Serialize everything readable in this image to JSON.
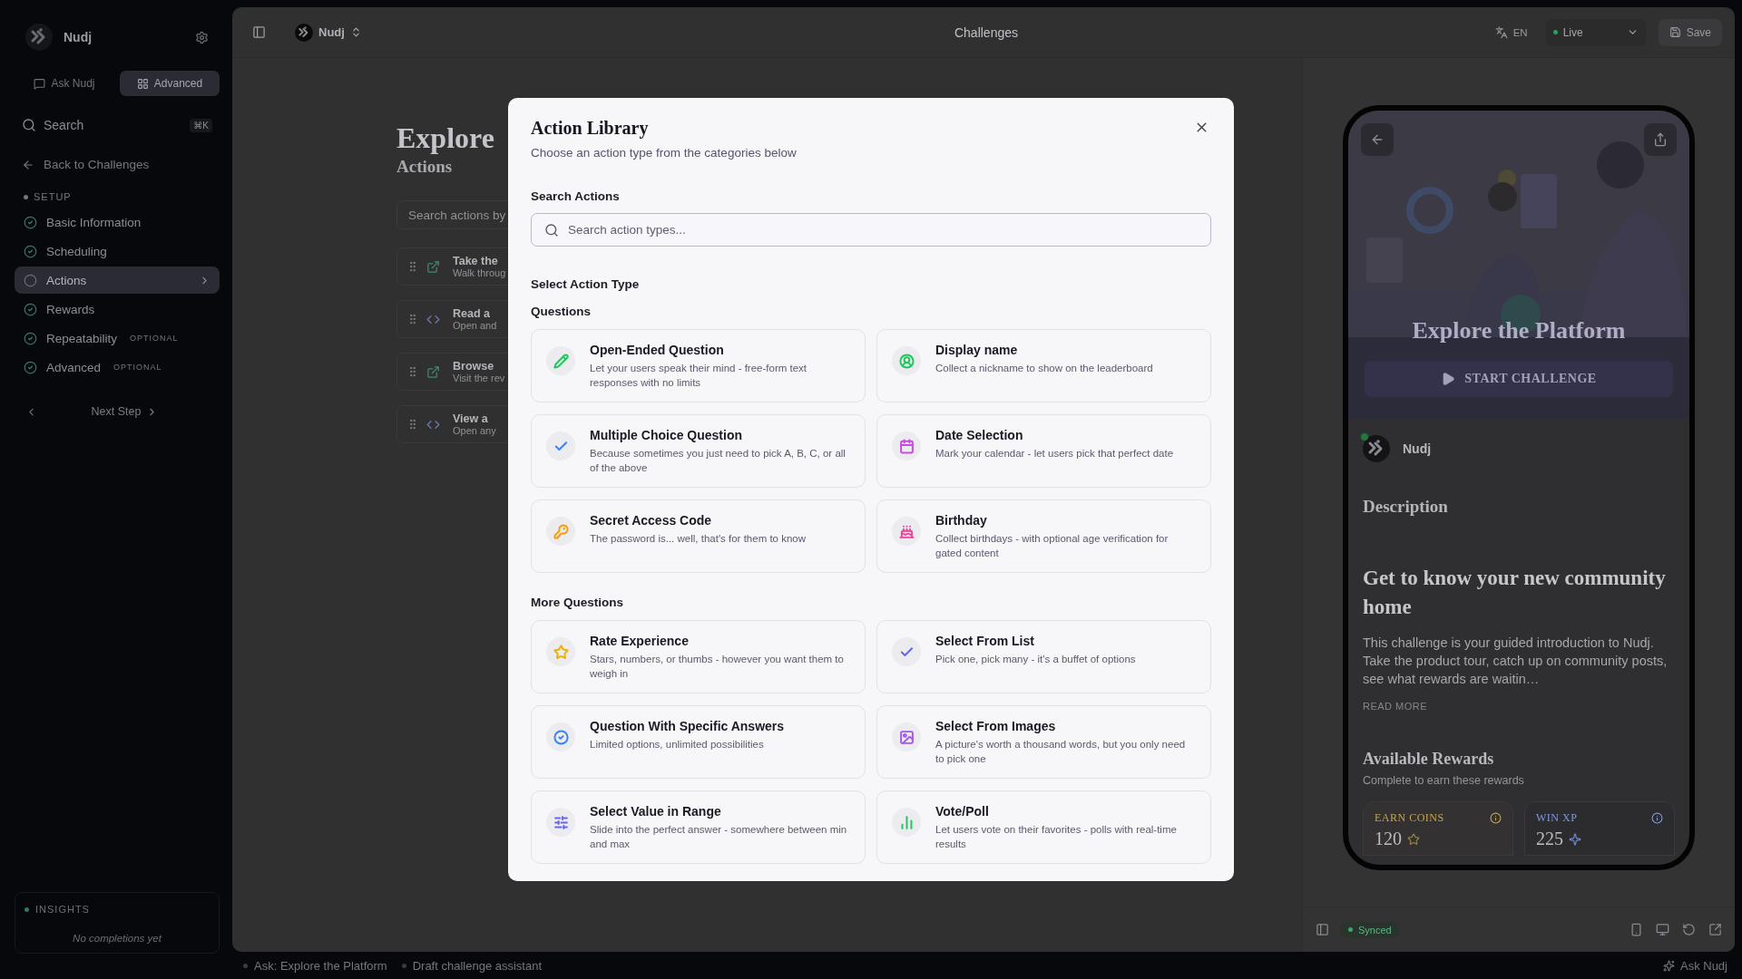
{
  "sidebar": {
    "brand": "Nudj",
    "modes": [
      {
        "label": "Ask Nudj",
        "selected": false
      },
      {
        "label": "Advanced",
        "selected": true
      }
    ],
    "search": {
      "placeholder": "Search",
      "shortcut": "⌘K"
    },
    "back_link": "Back to Challenges",
    "section": "SETUP",
    "steps": [
      {
        "label": "Basic Information",
        "done": true,
        "selected": false
      },
      {
        "label": "Scheduling",
        "done": true,
        "selected": false
      },
      {
        "label": "Actions",
        "done": false,
        "selected": true
      },
      {
        "label": "Rewards",
        "done": true,
        "selected": false
      },
      {
        "label": "Repeatability",
        "badge": "OPTIONAL",
        "done": true,
        "selected": false
      },
      {
        "label": "Advanced",
        "badge": "OPTIONAL",
        "done": true,
        "selected": false
      }
    ],
    "next_step": "Next Step",
    "insights": {
      "title": "INSIGHTS",
      "empty": "No completions yet"
    }
  },
  "topbar": {
    "workspace": "Nudj",
    "title": "Challenges",
    "language": "EN",
    "status": "Live",
    "save": "Save"
  },
  "editor": {
    "title": "Explore",
    "subtitle": "Actions",
    "search_placeholder": "Search actions by",
    "actions": [
      {
        "kind": "link",
        "title": "Take the",
        "description": "Walk throug"
      },
      {
        "kind": "code",
        "title": "Read a",
        "description": "Open and"
      },
      {
        "kind": "link",
        "title": "Browse",
        "description": "Visit the rev"
      },
      {
        "kind": "code",
        "title": "View a",
        "description": "Open any"
      }
    ]
  },
  "preview": {
    "title": "Explore the Platform",
    "start": "START CHALLENGE",
    "brand": "Nudj",
    "description_heading": "Description",
    "headline": "Get to know your new community home",
    "body": "This challenge is your guided introduction to Nudj. Take the product tour, catch up on community posts, see what rewards are waitin…",
    "read_more": "READ MORE",
    "rewards_title": "Available Rewards",
    "rewards_subtitle": "Complete to earn these rewards",
    "rewards": [
      {
        "label": "EARN COINS",
        "value": "120",
        "color": "#c9a64a"
      },
      {
        "label": "WIN XP",
        "value": "225",
        "color": "#8199e0"
      }
    ],
    "sync": "Synced"
  },
  "modal": {
    "title": "Action Library",
    "subtitle": "Choose an action type from the categories below",
    "search_label": "Search Actions",
    "search_placeholder": "Search action types...",
    "select_label": "Select Action Type",
    "groups": [
      {
        "title": "Questions",
        "items": [
          {
            "kind": "text",
            "title": "Open-Ended Question",
            "description": "Let your users speak their mind - free-form text responses with no limits",
            "color": "#22c55e"
          },
          {
            "kind": "profile",
            "title": "Display name",
            "description": "Collect a nickname to show on the leaderboard",
            "color": "#22c55e"
          },
          {
            "kind": "choice",
            "title": "Multiple Choice Question",
            "description": "Because sometimes you just need to pick A, B, C, or all of the above",
            "color": "#3b82f6"
          },
          {
            "kind": "date",
            "title": "Date Selection",
            "description": "Mark your calendar - let users pick that perfect date",
            "color": "#c94ce0"
          },
          {
            "kind": "code",
            "title": "Secret Access Code",
            "description": "The password is... well, that's for them to know",
            "color": "#f59e0b"
          },
          {
            "kind": "birthday",
            "title": "Birthday",
            "description": "Collect birthdays - with optional age verification for gated content",
            "color": "#ec4899"
          }
        ]
      },
      {
        "title": "More Questions",
        "items": [
          {
            "kind": "rating",
            "title": "Rate Experience",
            "description": "Stars, numbers, or thumbs - however you want them to weigh in",
            "color": "#eab308"
          },
          {
            "kind": "list",
            "title": "Select From List",
            "description": "Pick one, pick many - it's a buffet of options",
            "color": "#6366f1"
          },
          {
            "kind": "answers",
            "title": "Question With Specific Answers",
            "description": "Limited options, unlimited possibilities",
            "color": "#3b82f6"
          },
          {
            "kind": "images",
            "title": "Select From Images",
            "description": "A picture's worth a thousand words, but you only need to pick one",
            "color": "#a855f7"
          },
          {
            "kind": "range",
            "title": "Select Value in Range",
            "description": "Slide into the perfect answer - somewhere between min and max",
            "color": "#6366f1"
          },
          {
            "kind": "poll",
            "title": "Vote/Poll",
            "description": "Let users vote on their favorites - polls with real-time results",
            "color": "#22c55e"
          }
        ]
      }
    ]
  },
  "footer": {
    "items": [
      "Ask: Explore the Platform",
      "Draft challenge assistant"
    ],
    "ask": "Ask Nudj"
  }
}
